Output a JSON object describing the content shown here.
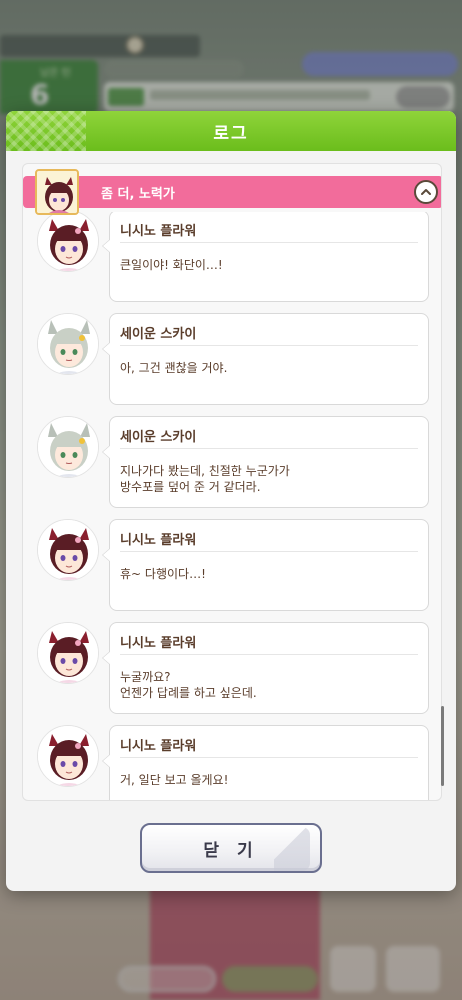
{
  "dialog": {
    "title": "로그",
    "close_label": "닫 기"
  },
  "chapter": {
    "title": "좀 더, 노력가"
  },
  "entries": [
    {
      "speaker": "니시노 플라워",
      "text": "큰일이야! 화단이…!",
      "character": "nishino-flower"
    },
    {
      "speaker": "세이운 스카이",
      "text": "아, 그건 괜찮을 거야.",
      "character": "seiun-sky"
    },
    {
      "speaker": "세이운 스카이",
      "text": "지나가다 봤는데, 친절한 누군가가\n방수포를 덮어 준 거 같더라.",
      "character": "seiun-sky"
    },
    {
      "speaker": "니시노 플라워",
      "text": "휴~ 다행이다…!",
      "character": "nishino-flower"
    },
    {
      "speaker": "니시노 플라워",
      "text": "누굴까요?\n언젠가 답례를 하고 싶은데.",
      "character": "nishino-flower"
    },
    {
      "speaker": "니시노 플라워",
      "text": "거, 일단 보고 올게요!",
      "character": "nishino-flower"
    }
  ],
  "background": {
    "turn_label": "남은 턴",
    "turn_number": "6"
  },
  "colors": {
    "header_green": "#6bbd1c",
    "chapter_pink": "#f26c9b",
    "text_brown": "#5a3d2b"
  }
}
